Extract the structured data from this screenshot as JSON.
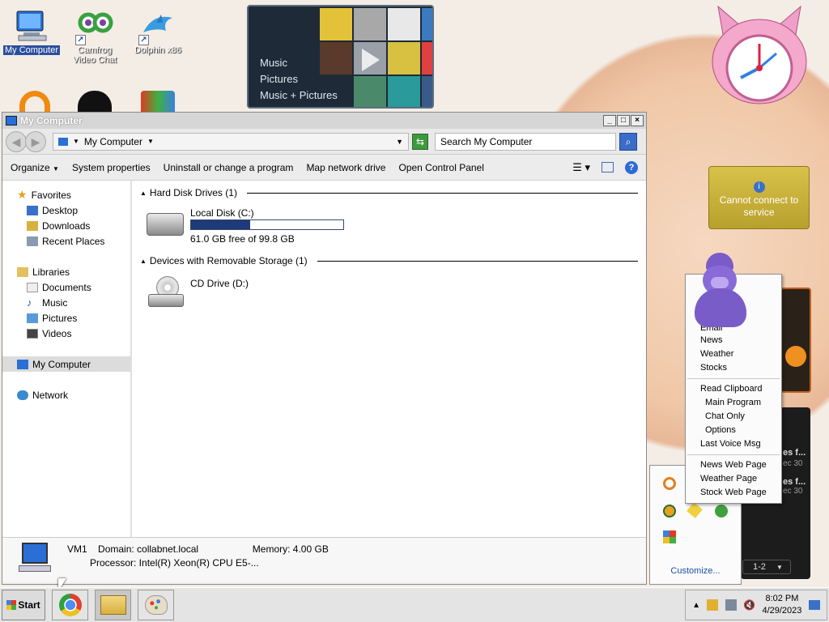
{
  "desktop": {
    "icons": [
      {
        "label": "My Computer"
      },
      {
        "label": "Camfrog Video Chat"
      },
      {
        "label": "Dolphin x86"
      }
    ]
  },
  "media_gadget": {
    "items": [
      "Music",
      "Pictures",
      "Music + Pictures"
    ]
  },
  "gadget_cc": {
    "text": "Cannot connect to service"
  },
  "window": {
    "title": "My Computer",
    "address": "My Computer",
    "search_placeholder": "Search My Computer",
    "toolbar": [
      "Organize",
      "System properties",
      "Uninstall or change a program",
      "Map network drive",
      "Open Control Panel"
    ],
    "nav": {
      "favorites": "Favorites",
      "fav_items": [
        "Desktop",
        "Downloads",
        "Recent Places"
      ],
      "libraries": "Libraries",
      "lib_items": [
        "Documents",
        "Music",
        "Pictures",
        "Videos"
      ],
      "computer": "My Computer",
      "network": "Network"
    },
    "groups": {
      "hdd": "Hard Disk Drives (1)",
      "removable": "Devices with Removable Storage (1)"
    },
    "drives": {
      "c_name": "Local Disk (C:)",
      "c_free": "61.0 GB free of 99.8 GB",
      "c_used_fraction": 0.39,
      "d_name": "CD Drive (D:)"
    },
    "details": {
      "name": "VM1",
      "domain": "Domain: collabnet.local",
      "memory": "Memory: 4.00 GB",
      "processor": "Processor: Intel(R) Xeon(R) CPU E5-..."
    }
  },
  "menu": {
    "group1": [
      "Email",
      "News",
      "Weather",
      "Stocks"
    ],
    "read_clipboard": "Read Clipboard",
    "group2": [
      "Main Program",
      "Chat Only",
      "Options"
    ],
    "last_voice": "Last Voice Msg",
    "group3": [
      "News Web Page",
      "Weather Page",
      "Stock Web Page"
    ]
  },
  "tray_overflow": {
    "customize": "Customize..."
  },
  "feed": {
    "pager": "1-2",
    "items": [
      "es f...",
      "ec 30",
      "es f...",
      "ec 30"
    ]
  },
  "taskbar": {
    "start": "Start",
    "time": "8:02 PM",
    "date": "4/29/2023"
  }
}
